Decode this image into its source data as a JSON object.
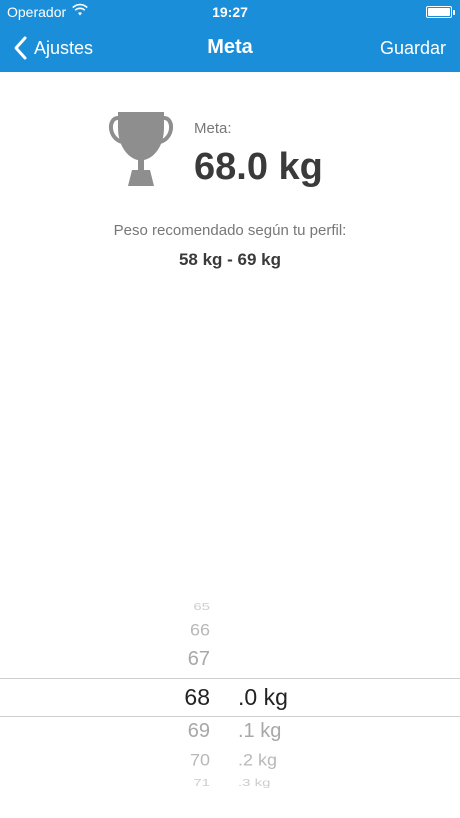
{
  "status_bar": {
    "carrier": "Operador",
    "time": "19:27"
  },
  "nav": {
    "back_label": "Ajustes",
    "title": "Meta",
    "save_label": "Guardar"
  },
  "goal": {
    "label": "Meta:",
    "value": "68.0 kg"
  },
  "recommendation": {
    "text": "Peso recomendado según tu perfil:",
    "range": "58 kg - 69 kg"
  },
  "picker": {
    "whole": [
      "65",
      "66",
      "67",
      "68",
      "69",
      "70",
      "71"
    ],
    "whole_selected_index": 3,
    "decimal": [
      ".0 kg",
      ".1 kg",
      ".2 kg",
      ".3 kg"
    ],
    "decimal_selected_index": 0
  },
  "colors": {
    "accent": "#1a8ed8",
    "text_dark": "#3a3a3a",
    "text_muted": "#777777",
    "trophy": "#8e8e8e"
  }
}
